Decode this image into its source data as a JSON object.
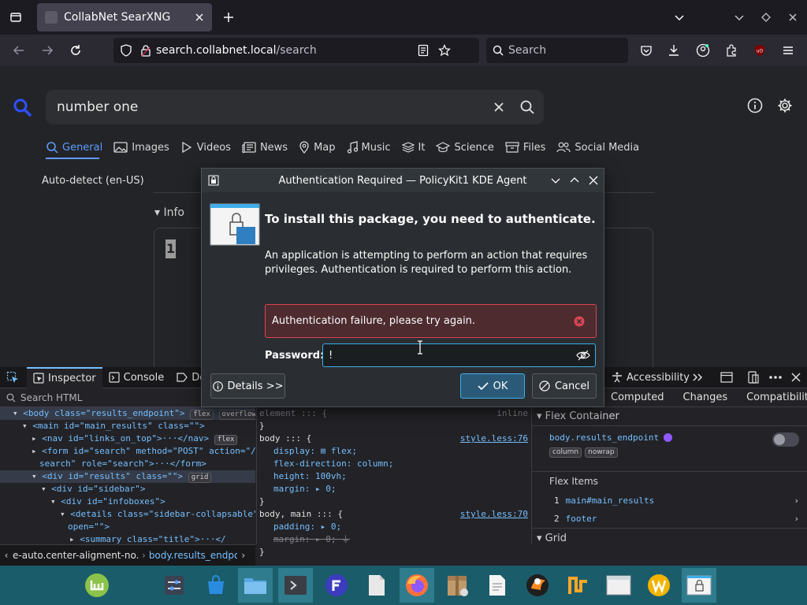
{
  "browser": {
    "tab_title": "CollabNet SearXNG",
    "url_domain": "search.collabnet.local",
    "url_path": "/search",
    "search_placeholder": "Search"
  },
  "page": {
    "query": "number one",
    "categories": [
      "General",
      "Images",
      "Videos",
      "News",
      "Map",
      "Music",
      "It",
      "Science",
      "Files",
      "Social Media"
    ],
    "active_category": "General",
    "language": "Auto-detect (en-US)",
    "info_label": "Info",
    "infobox_number": "1"
  },
  "dialog": {
    "title": "Authentication Required — PolicyKit1 KDE Agent",
    "heading": "To install this package, you need to authenticate.",
    "body": "An application is attempting to perform an action that requires privileges. Authentication is required to perform this action.",
    "error": "Authentication failure, please try again.",
    "password_label": "Password:",
    "password_value": "!",
    "details_label": "Details >>",
    "ok_label": "OK",
    "cancel_label": "Cancel",
    "colors": {
      "accent": "#3daee9",
      "error": "#da4453"
    }
  },
  "devtools": {
    "tabs": [
      "Inspector",
      "Console",
      "De"
    ],
    "search_placeholder": "Search HTML",
    "html_lines": [
      {
        "indent": 0,
        "text": "<body class=\"results_endpoint\">",
        "badges": [
          "flex",
          "overflow"
        ],
        "selected": true
      },
      {
        "indent": 1,
        "text": "<main id=\"main_results\" class=\"\">",
        "badges": []
      },
      {
        "indent": 2,
        "text": "<nav id=\"links_on_top\">···</nav>",
        "badges": [
          "flex"
        ]
      },
      {
        "indent": 2,
        "text": "<form id=\"search\" method=\"POST\" action=\"/",
        "badges": []
      },
      {
        "indent": 2,
        "text": "search\" role=\"search\">···</form>",
        "badges": []
      },
      {
        "indent": 2,
        "text": "<div id=\"results\" class=\"\">",
        "badges": [
          "grid"
        ],
        "hover": true
      },
      {
        "indent": 3,
        "text": "<div id=\"sidebar\">",
        "badges": []
      },
      {
        "indent": 4,
        "text": "<div id=\"infoboxes\">",
        "badges": []
      },
      {
        "indent": 5,
        "text": "<details class=\"sidebar-collapsable\"",
        "badges": []
      },
      {
        "indent": 5,
        "text": "open=\"\">",
        "badges": []
      },
      {
        "indent": 6,
        "text": "<summary class=\"title\">···</",
        "badges": []
      }
    ],
    "css_lines": [
      {
        "text": "element ::: {",
        "src": "inline"
      },
      {
        "text": "}",
        "src": ""
      },
      {
        "text": "body ::: {",
        "src": "style.less:76"
      },
      {
        "text": "  display: ⊞ flex;",
        "src": ""
      },
      {
        "text": "  flex-direction: column;",
        "src": ""
      },
      {
        "text": "  height: 100vh;",
        "src": ""
      },
      {
        "text": "  margin: ▸ 0;",
        "src": ""
      },
      {
        "text": "}",
        "src": ""
      },
      {
        "text": "body, main ::: {",
        "src": "style.less:70"
      },
      {
        "text": "  padding: ▸ 0;",
        "src": ""
      },
      {
        "text": "  margin: ▸ 0;",
        "src": "",
        "struck": true
      },
      {
        "text": "}",
        "src": ""
      }
    ],
    "right_tabs": [
      "Accessibility"
    ],
    "right_subtabs": [
      "Computed",
      "Changes",
      "Compatibility"
    ],
    "flex_container_label": "Flex Container",
    "flex_container_element": "body.results_endpoint",
    "flex_container_badges": [
      "column",
      "nowrap"
    ],
    "flex_items_label": "Flex Items",
    "flex_items": [
      {
        "n": "1",
        "name": "main#main_results"
      },
      {
        "n": "2",
        "name": "footer"
      }
    ],
    "grid_label": "Grid",
    "breadcrumb": [
      "e-auto.center-aligment-no.js",
      "body.results_endpoir"
    ]
  }
}
